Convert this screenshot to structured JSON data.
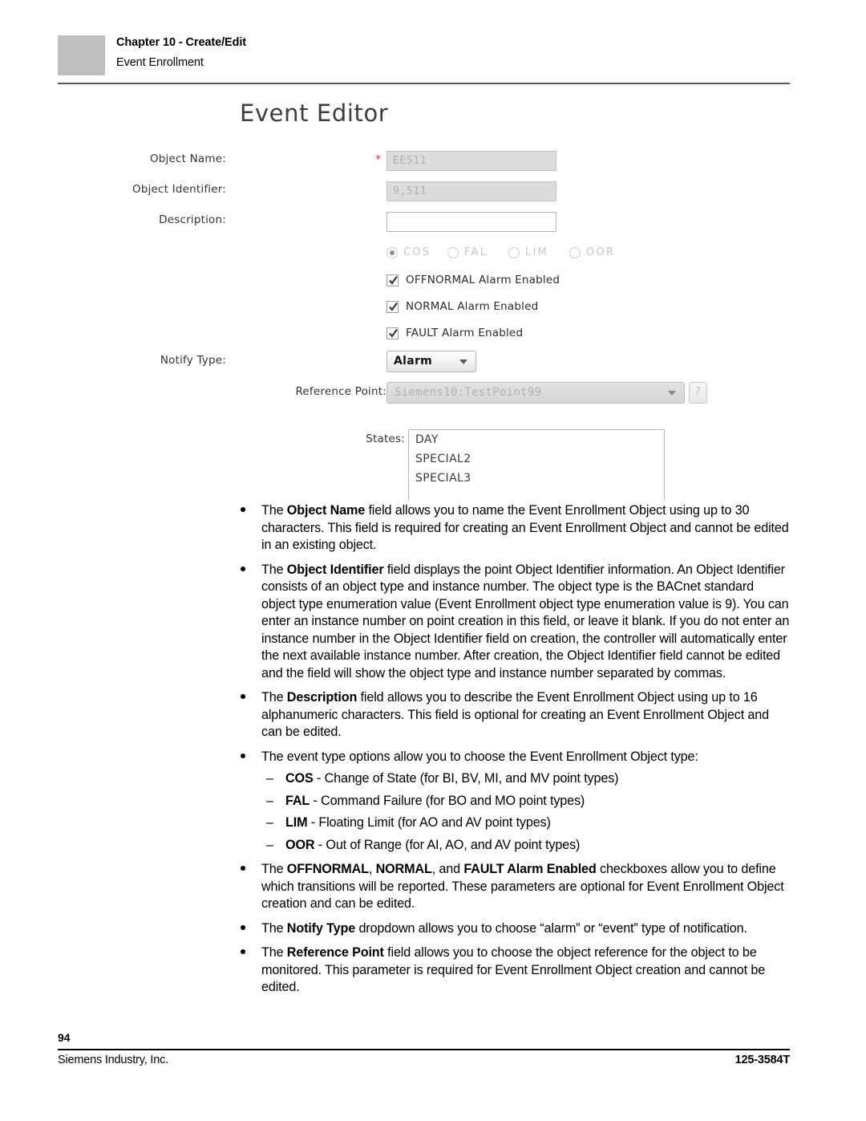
{
  "header": {
    "chapter": "Chapter 10 - Create/Edit",
    "subtitle": "Event Enrollment"
  },
  "form": {
    "title": "Event Editor",
    "fields": {
      "object_name": {
        "label": "Object Name:",
        "value": "EE511",
        "required_marker": "*",
        "disabled": true
      },
      "object_identifier": {
        "label": "Object Identifier:",
        "value": "9,511",
        "disabled": true
      },
      "description": {
        "label": "Description:",
        "value": "",
        "disabled": false
      },
      "notify_type": {
        "label": "Notify Type:",
        "value": "Alarm"
      },
      "reference_point": {
        "label": "Reference Point:",
        "value": "Siemens10:TestPoint99",
        "help_label": "?",
        "disabled": true
      },
      "states": {
        "label": "States:",
        "options": [
          "DAY",
          "SPECIAL2",
          "SPECIAL3"
        ]
      }
    },
    "event_type_radios": [
      {
        "label": "COS",
        "selected": true
      },
      {
        "label": "FAL",
        "selected": false
      },
      {
        "label": "LIM",
        "selected": false
      },
      {
        "label": "OOR",
        "selected": false
      }
    ],
    "checkboxes": [
      {
        "label": "OFFNORMAL Alarm Enabled",
        "checked": true
      },
      {
        "label": "NORMAL Alarm Enabled",
        "checked": true
      },
      {
        "label": "FAULT Alarm Enabled",
        "checked": true
      }
    ],
    "colors": {
      "required_star": "#e0402a",
      "title": "#3d3d3d",
      "disabled_field_bg": "#dcdcdc"
    }
  },
  "body": {
    "bullets": [
      {
        "html": "The <b>Object Name</b> field allows you to name the Event Enrollment Object using up to 30 characters. This field is required for creating an Event Enrollment Object and cannot be edited in an existing object."
      },
      {
        "html": "The <b>Object Identifier</b> field displays the point Object Identifier information. An Object Identifier consists of an object type and instance number. The object type is the BACnet standard object type enumeration value (Event Enrollment object type enumeration value is 9). You can enter an instance number on point creation in this field, or leave it blank. If you do not enter an instance number in the Object Identifier field on creation, the controller will automatically enter the next available instance number. After creation, the Object Identifier field cannot be edited and the field will show the object type and instance number separated by commas."
      },
      {
        "html": "The <b>Description</b> field allows you to describe the Event Enrollment Object using up to 16 alphanumeric characters. This field is optional for creating an Event Enrollment Object and can be edited."
      },
      {
        "html": "The event type options allow you to choose the Event Enrollment Object type:",
        "sub": [
          {
            "dash": "–",
            "html": "<b>COS</b> - Change of State (for BI, BV, MI, and MV point types)"
          },
          {
            "dash": "–",
            "html": "<b>FAL</b> - Command Failure (for BO and MO point types)"
          },
          {
            "dash": "–",
            "html": "<b>LIM</b> - Floating Limit (for AO and AV point types)"
          },
          {
            "dash": "–",
            "html": "<b>OOR</b> - Out of Range (for AI, AO, and AV point types)"
          }
        ]
      },
      {
        "html": "The <b>OFFNORMAL</b>, <b>NORMAL</b>, and <b>FAULT Alarm Enabled</b> checkboxes allow you to define which transitions will be reported. These parameters are optional for Event Enrollment Object creation and can be edited."
      },
      {
        "html": "The <b>Notify Type</b> dropdown allows you to choose “alarm” or “event” type of notification."
      },
      {
        "html": "The <b>Reference Point</b> field allows you to choose the object reference for the object to be monitored. This parameter is required for Event Enrollment Object creation and cannot be edited."
      }
    ]
  },
  "footer": {
    "page_number": "94",
    "company": "Siemens Industry, Inc.",
    "document_number": "125-3584T"
  }
}
